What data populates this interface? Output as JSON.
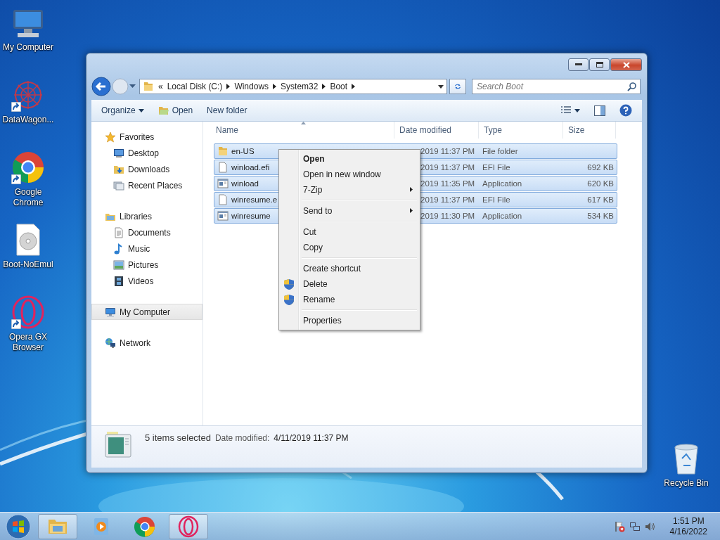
{
  "desktop_icons": [
    {
      "label": "My Computer",
      "kind": "computer",
      "shortcut": false
    },
    {
      "label": "DataWagon...",
      "kind": "web",
      "shortcut": true
    },
    {
      "label": "Google Chrome",
      "kind": "chrome",
      "shortcut": true
    },
    {
      "label": "Boot-NoEmul",
      "kind": "disc",
      "shortcut": false
    },
    {
      "label": "Opera GX Browser",
      "kind": "opera",
      "shortcut": true
    }
  ],
  "recycle_bin": {
    "label": "Recycle Bin"
  },
  "window": {
    "address": {
      "crumbs": [
        "Local Disk (C:)",
        "Windows",
        "System32",
        "Boot"
      ],
      "overflow": "«"
    },
    "search": {
      "placeholder": "Search Boot"
    },
    "toolbar": [
      {
        "label": "Organize",
        "kind": "menu"
      },
      {
        "label": "Open",
        "kind": "open"
      },
      {
        "label": "New folder",
        "kind": "plain"
      }
    ],
    "sidebar": [
      {
        "label": "Favorites",
        "kind": "star",
        "selected": false,
        "children": [
          {
            "label": "Desktop",
            "kind": "desktop",
            "selected": false
          },
          {
            "label": "Downloads",
            "kind": "downloads",
            "selected": false
          },
          {
            "label": "Recent Places",
            "kind": "recent",
            "selected": false
          }
        ]
      },
      {
        "label": "Libraries",
        "kind": "libraries",
        "selected": false,
        "children": [
          {
            "label": "Documents",
            "kind": "documents",
            "selected": false
          },
          {
            "label": "Music",
            "kind": "music",
            "selected": false
          },
          {
            "label": "Pictures",
            "kind": "pictures",
            "selected": false
          },
          {
            "label": "Videos",
            "kind": "videos",
            "selected": false
          }
        ]
      },
      {
        "label": "My Computer",
        "kind": "computer",
        "selected": true
      },
      {
        "label": "Network",
        "kind": "network",
        "selected": false
      }
    ],
    "columns": [
      "Name",
      "Date modified",
      "Type",
      "Size"
    ],
    "rows": [
      {
        "name": "en-US",
        "kind": "folder",
        "date": "2019 11:37 PM",
        "type": "File folder",
        "selected": true
      },
      {
        "name": "winload.efi",
        "kind": "file",
        "date": "2019 11:37 PM",
        "type": "EFI File",
        "size": "692 KB",
        "selected": true
      },
      {
        "name": "winload",
        "kind": "app",
        "date": "2019 11:35 PM",
        "type": "Application",
        "size": "620 KB",
        "selected": true
      },
      {
        "name": "winresume.e",
        "kind": "file",
        "date": "2019 11:37 PM",
        "type": "EFI File",
        "size": "617 KB",
        "selected": true
      },
      {
        "name": "winresume",
        "kind": "app",
        "date": "2019 11:30 PM",
        "type": "Application",
        "size": "534 KB",
        "selected": true
      }
    ],
    "details": {
      "summary": "5 items selected",
      "date_label": "Date modified:",
      "date_value": "4/11/2019 11:37 PM"
    }
  },
  "context_menu": {
    "groups": [
      [
        {
          "label": "Open",
          "default": true,
          "submenu": false,
          "shield": false
        },
        {
          "label": "Open in new window",
          "default": false,
          "submenu": false,
          "shield": false
        },
        {
          "label": "7-Zip",
          "default": false,
          "submenu": true,
          "shield": false
        }
      ],
      [
        {
          "label": "Send to",
          "default": false,
          "submenu": true,
          "shield": false
        }
      ],
      [
        {
          "label": "Cut",
          "default": false,
          "submenu": false,
          "shield": false
        },
        {
          "label": "Copy",
          "default": false,
          "submenu": false,
          "shield": false
        }
      ],
      [
        {
          "label": "Create shortcut",
          "default": false,
          "submenu": false,
          "shield": false
        },
        {
          "label": "Delete",
          "default": false,
          "submenu": false,
          "shield": true
        },
        {
          "label": "Rename",
          "default": false,
          "submenu": false,
          "shield": true
        }
      ],
      [
        {
          "label": "Properties",
          "default": false,
          "submenu": false,
          "shield": false
        }
      ]
    ]
  },
  "taskbar": {
    "buttons": [
      {
        "kind": "explorer",
        "open": true
      },
      {
        "kind": "media",
        "open": false
      },
      {
        "kind": "chrome",
        "open": false
      },
      {
        "kind": "opera",
        "open": true
      }
    ],
    "time": "1:51 PM",
    "date": "4/16/2022"
  }
}
